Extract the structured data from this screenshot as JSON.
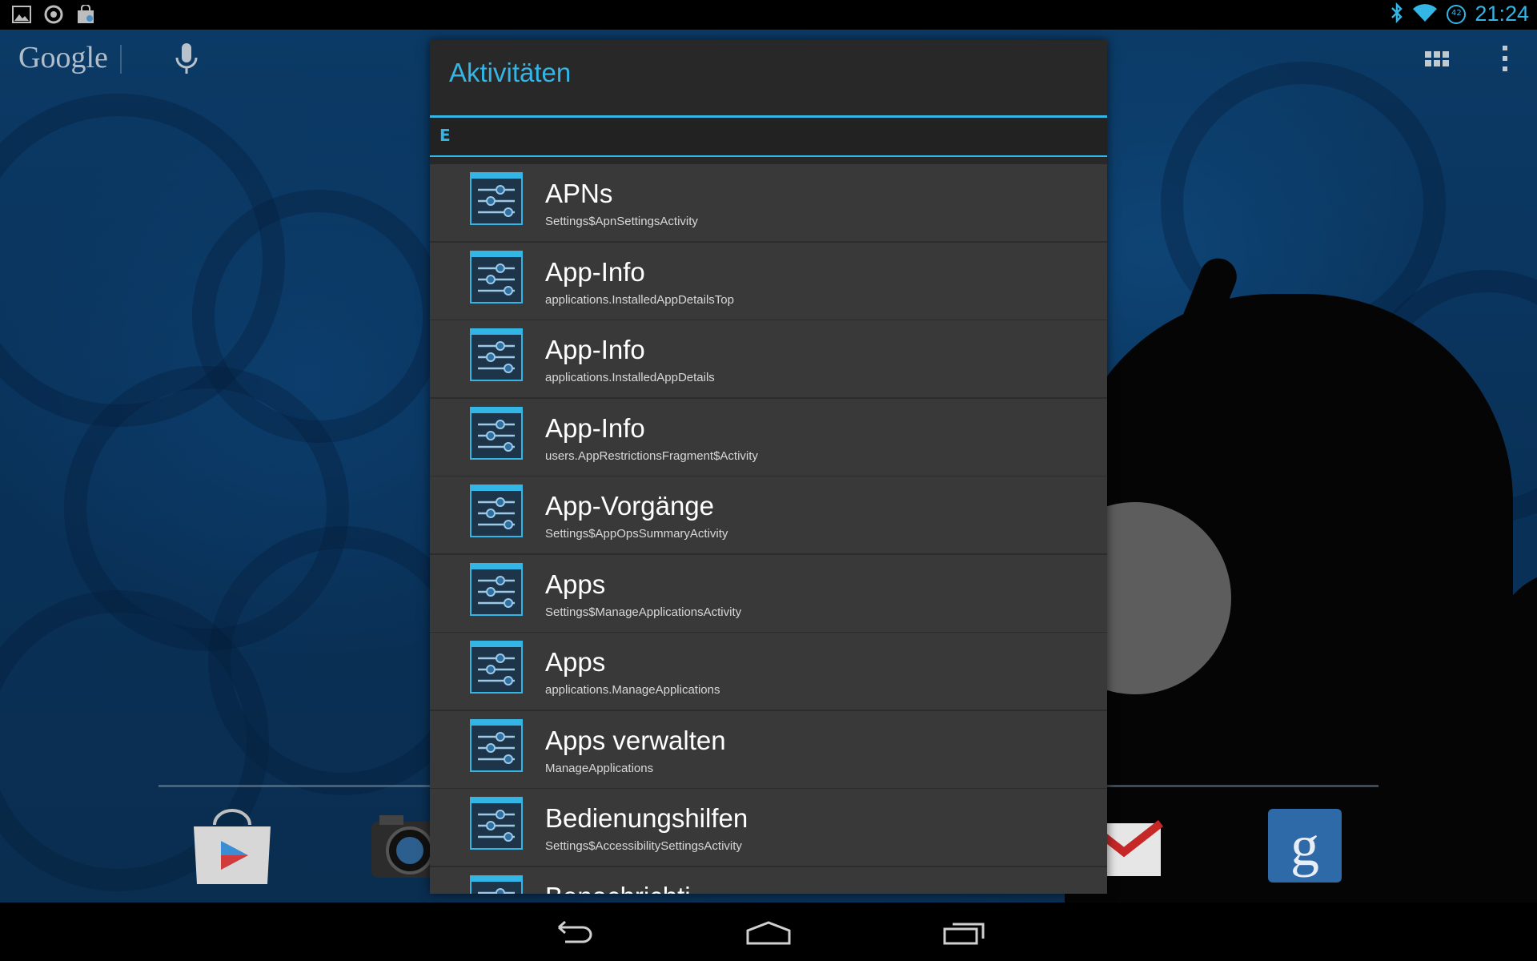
{
  "status_bar": {
    "left_icons": [
      "gallery-icon",
      "sync-icon",
      "shopping-bag-icon"
    ],
    "right_icons": [
      "bluetooth-icon",
      "wifi-icon",
      "battery-icon"
    ],
    "battery_level": "42",
    "time": "21:24"
  },
  "search": {
    "logo": "Google",
    "mic_icon": "microphone-icon"
  },
  "dialog": {
    "title": "Aktivitäten",
    "section_letter": "E",
    "items": [
      {
        "label": "APNs",
        "sub": "Settings$ApnSettingsActivity"
      },
      {
        "label": "App-Info",
        "sub": "applications.InstalledAppDetailsTop"
      },
      {
        "label": "App-Info",
        "sub": "applications.InstalledAppDetails"
      },
      {
        "label": "App-Info",
        "sub": "users.AppRestrictionsFragment$Activity"
      },
      {
        "label": "App-Vorgänge",
        "sub": "Settings$AppOpsSummaryActivity"
      },
      {
        "label": "Apps",
        "sub": "Settings$ManageApplicationsActivity"
      },
      {
        "label": "Apps",
        "sub": "applications.ManageApplications"
      },
      {
        "label": "Apps verwalten",
        "sub": "ManageApplications"
      },
      {
        "label": "Bedienungshilfen",
        "sub": "Settings$AccessibilitySettingsActivity"
      },
      {
        "label": "Benachrichti...",
        "sub": ""
      }
    ]
  },
  "dock": {
    "icons": [
      "play-store-icon",
      "camera-icon",
      "gmail-icon",
      "google-search-icon"
    ]
  },
  "nav": {
    "buttons": [
      "back-button",
      "home-button",
      "recents-button"
    ]
  },
  "colors": {
    "accent": "#33b5e5",
    "dialog_bg": "#282828",
    "row_bg": "#393939"
  }
}
